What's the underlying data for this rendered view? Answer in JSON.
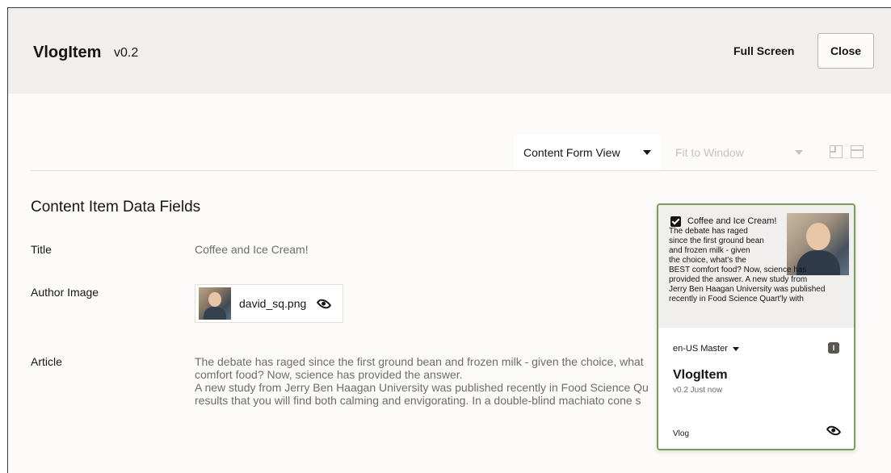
{
  "dialog": {
    "title": "VlogItem",
    "version": "v0.2",
    "full_screen_label": "Full Screen",
    "close_label": "Close"
  },
  "toolbar": {
    "view_mode": "Content Form View",
    "zoom_mode": "Fit to Window",
    "icons": [
      "split-layout-icon",
      "panel-layout-icon"
    ]
  },
  "form": {
    "section_title": "Content Item Data Fields",
    "fields": [
      {
        "label": "Title",
        "value": "Coffee and Ice Cream!"
      },
      {
        "label": "Author Image",
        "value": "david_sq.png"
      },
      {
        "label": "Article",
        "lines": [
          "The debate has raged since the first ground bean and frozen milk - given the choice, what",
          "comfort food? Now, science has provided the answer.",
          "A new study from Jerry Ben Haagan University was published recently in Food Science Qu",
          "results that you will find both calming and envigorating. In a double-blind machiato cone s"
        ]
      }
    ]
  },
  "card": {
    "heading": "Coffee and Ice Cream!",
    "text_lines": [
      "The debate has raged",
      "since the first ground bean",
      "and frozen milk - given",
      "the choice, what's the",
      "BEST comfort food? Now, science has",
      "provided the answer. A new study from",
      "Jerry Ben Haagan University was published",
      "recently in Food Science Quart'ly with"
    ],
    "language": "en-US Master",
    "status_badge": "I",
    "name": "VlogItem",
    "meta": "v0.2   Just now",
    "type": "Vlog"
  },
  "colors": {
    "card_border": "#7a9e5a",
    "header_bg": "#f1efed"
  }
}
